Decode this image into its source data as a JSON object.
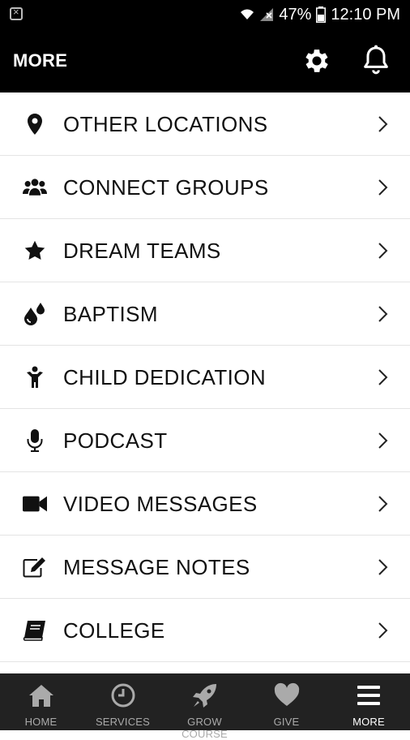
{
  "status": {
    "battery": "47%",
    "time": "12:10 PM"
  },
  "header": {
    "title": "MORE"
  },
  "menu": [
    {
      "label": "OTHER LOCATIONS",
      "icon": "map-pin-icon"
    },
    {
      "label": "CONNECT GROUPS",
      "icon": "group-icon"
    },
    {
      "label": "DREAM TEAMS",
      "icon": "star-icon"
    },
    {
      "label": "BAPTISM",
      "icon": "water-drops-icon"
    },
    {
      "label": "CHILD DEDICATION",
      "icon": "child-icon"
    },
    {
      "label": "PODCAST",
      "icon": "microphone-icon"
    },
    {
      "label": "VIDEO MESSAGES",
      "icon": "video-camera-icon"
    },
    {
      "label": "MESSAGE NOTES",
      "icon": "edit-note-icon"
    },
    {
      "label": "COLLEGE",
      "icon": "book-icon"
    }
  ],
  "tabs": [
    {
      "label": "HOME",
      "icon": "home-icon",
      "active": false
    },
    {
      "label": "SERVICES",
      "icon": "clock-icon",
      "active": false
    },
    {
      "label": "GROW COURSE",
      "icon": "rocket-icon",
      "active": false
    },
    {
      "label": "GIVE",
      "icon": "heart-icon",
      "active": false
    },
    {
      "label": "MORE",
      "icon": "menu-icon",
      "active": true
    }
  ]
}
